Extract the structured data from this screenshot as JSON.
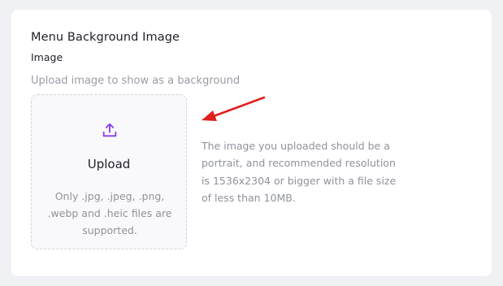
{
  "section": {
    "title": "Menu Background Image"
  },
  "field": {
    "label": "Image",
    "helper": "Upload image to show as a background"
  },
  "dropzone": {
    "icon": "upload-icon",
    "label": "Upload",
    "formats": "Only .jpg, .jpeg, .png, .webp and .heic files are supported."
  },
  "note": "The image you uploaded should be a portrait, and recommended resolution is 1536x2304 or bigger with a file size of less than 10MB.",
  "colors": {
    "accent": "#8a3ff0",
    "annotation_arrow": "#e0201e"
  }
}
